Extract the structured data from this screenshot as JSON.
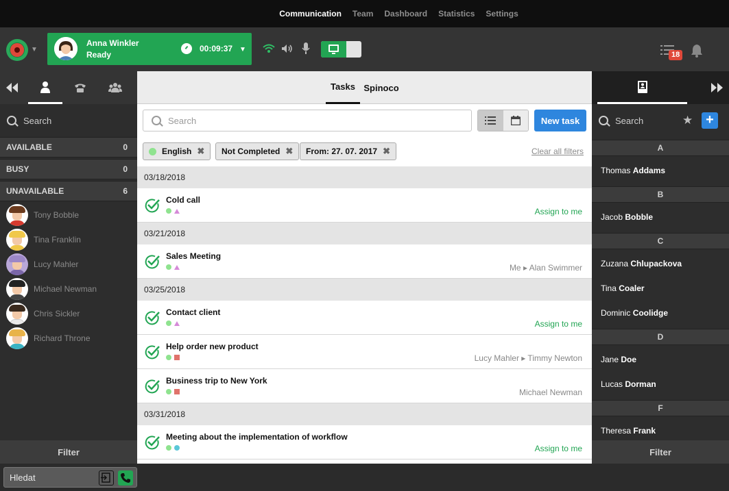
{
  "topnav": {
    "items": [
      "Communication",
      "Team",
      "Dashboard",
      "Statistics",
      "Settings"
    ],
    "active_index": 0
  },
  "header": {
    "agent_name": "Anna Winkler",
    "agent_status": "Ready",
    "call_timer": "00:09:37",
    "tasks_badge": "18"
  },
  "left_panel": {
    "search_placeholder": "Search",
    "groups": [
      {
        "label": "AVAILABLE",
        "count": "0"
      },
      {
        "label": "BUSY",
        "count": "0"
      },
      {
        "label": "UNAVAILABLE",
        "count": "6"
      }
    ],
    "contacts": [
      "Tony Bobble",
      "Tina Franklin",
      "Lucy Mahler",
      "Michael Newman",
      "Chris Sickler",
      "Richard Throne"
    ],
    "filter_label": "Filter"
  },
  "center": {
    "tabs": [
      "Tasks",
      "Spinoco"
    ],
    "search_placeholder": "Search",
    "new_task_label": "New task",
    "filters": [
      "English",
      "Not Completed",
      "From: 27. 07. 2017"
    ],
    "clear_filters_label": "Clear all filters",
    "dates": [
      "03/18/2018",
      "03/21/2018",
      "03/25/2018",
      "03/31/2018"
    ],
    "tasks": [
      {
        "title": "Cold call",
        "right": "Assign to me"
      },
      {
        "title": "Sales Meeting",
        "right": "Me ▸ Alan Swimmer"
      },
      {
        "title": "Contact client",
        "right": "Assign to me"
      },
      {
        "title": "Help order new product",
        "right": "Lucy Mahler ▸ Timmy Newton"
      },
      {
        "title": "Business trip to New York",
        "right": "Michael Newman"
      },
      {
        "title": "Meeting about the implementation of workflow",
        "right": "Assign to me"
      }
    ]
  },
  "right_panel": {
    "search_placeholder": "Search",
    "letters": [
      "A",
      "B",
      "C",
      "D",
      "F"
    ],
    "contacts": [
      {
        "first": "Thomas",
        "last": "Addams"
      },
      {
        "first": "Jacob",
        "last": "Bobble"
      },
      {
        "first": "Zuzana",
        "last": "Chlupackova"
      },
      {
        "first": "Tina",
        "last": "Coaler"
      },
      {
        "first": "Dominic",
        "last": "Coolidge"
      },
      {
        "first": "Jane",
        "last": "Doe"
      },
      {
        "first": "Lucas",
        "last": "Dorman"
      },
      {
        "first": "Theresa",
        "last": "Frank"
      }
    ],
    "filter_label": "Filter"
  },
  "footer": {
    "dialer_placeholder": "Hledat"
  },
  "colors": {
    "accent_green": "#22a553",
    "accent_blue": "#2e86de",
    "badge_red": "#e0483a"
  }
}
